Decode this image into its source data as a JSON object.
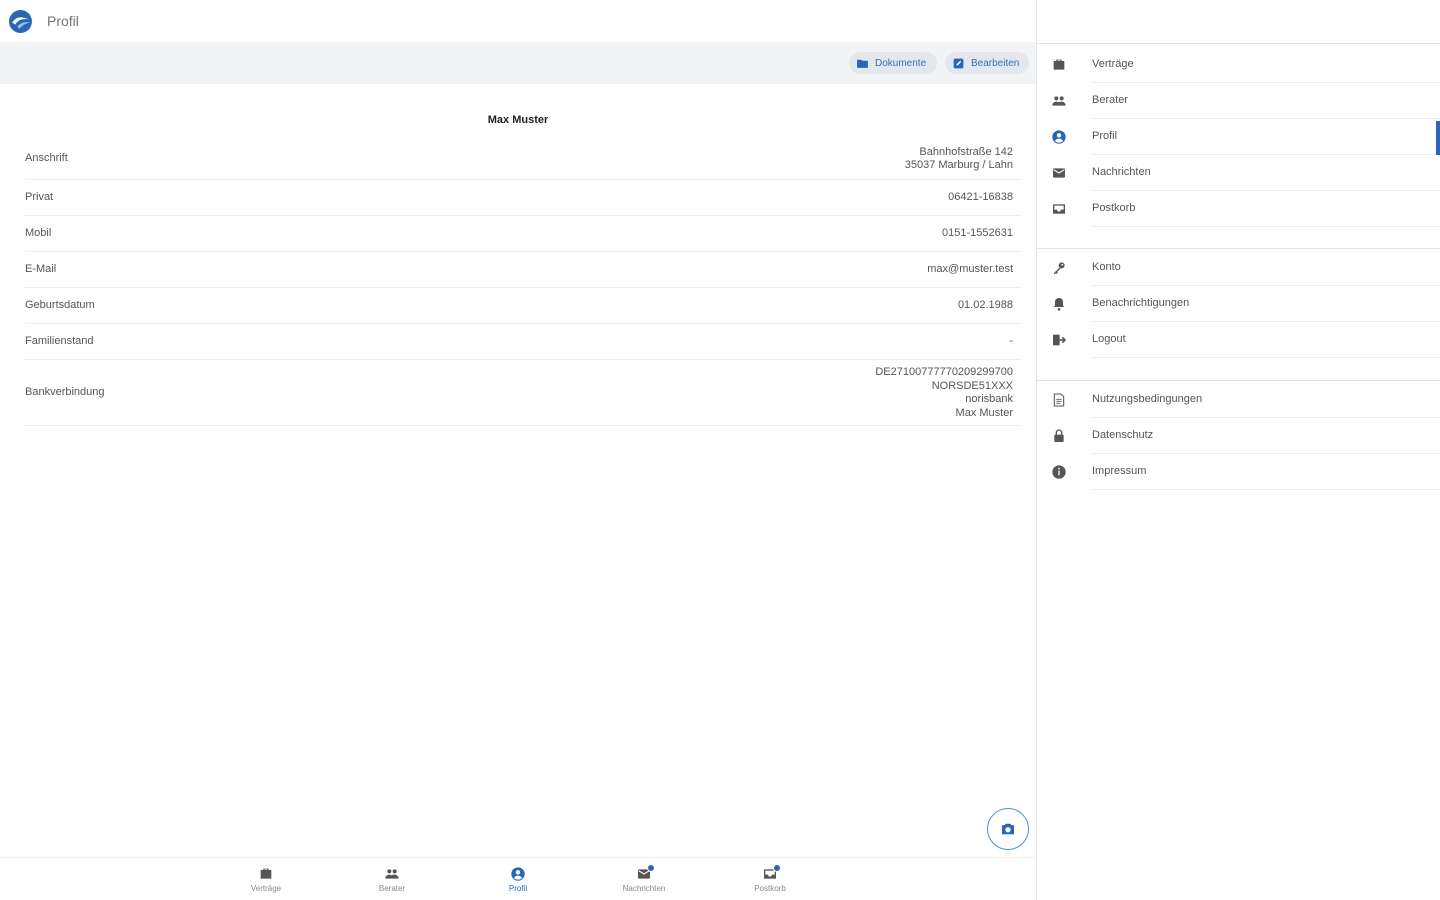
{
  "header": {
    "title": "Profil"
  },
  "actions": {
    "documents_label": "Dokumente",
    "edit_label": "Bearbeiten"
  },
  "profile": {
    "name": "Max Muster",
    "fields": [
      {
        "label": "Anschrift",
        "value_lines": [
          "Bahnhofstraße 142",
          "35037 Marburg / Lahn"
        ]
      },
      {
        "label": "Privat",
        "value_lines": [
          "06421-16838"
        ]
      },
      {
        "label": "Mobil",
        "value_lines": [
          "0151-1552631"
        ]
      },
      {
        "label": "E-Mail",
        "value_lines": [
          "max@muster.test"
        ]
      },
      {
        "label": "Geburtsdatum",
        "value_lines": [
          "01.02.1988"
        ]
      },
      {
        "label": "Familienstand",
        "value_lines": [
          "-"
        ]
      },
      {
        "label": "Bankverbindung",
        "value_lines": [
          "DE27100777770209299700",
          "NORSDE51XXX",
          "norisbank",
          "Max Muster"
        ]
      }
    ]
  },
  "bottom_nav": {
    "items": [
      {
        "label": "Verträge",
        "icon": "briefcase-icon",
        "active": false,
        "badge": false
      },
      {
        "label": "Berater",
        "icon": "people-icon",
        "active": false,
        "badge": false
      },
      {
        "label": "Profil",
        "icon": "account-circle-icon",
        "active": true,
        "badge": false
      },
      {
        "label": "Nachrichten",
        "icon": "mail-icon",
        "active": false,
        "badge": true
      },
      {
        "label": "Postkorb",
        "icon": "inbox-icon",
        "active": false,
        "badge": true
      }
    ]
  },
  "drawer": {
    "groups": [
      [
        {
          "label": "Verträge",
          "icon": "briefcase-icon",
          "active": false
        },
        {
          "label": "Berater",
          "icon": "people-icon",
          "active": false
        },
        {
          "label": "Profil",
          "icon": "account-circle-icon",
          "active": true
        },
        {
          "label": "Nachrichten",
          "icon": "mail-icon",
          "active": false
        },
        {
          "label": "Postkorb",
          "icon": "inbox-icon",
          "active": false
        }
      ],
      [
        {
          "label": "Konto",
          "icon": "key-icon",
          "active": false
        },
        {
          "label": "Benachrichtigungen",
          "icon": "bell-icon",
          "active": false
        },
        {
          "label": "Logout",
          "icon": "logout-icon",
          "active": false
        }
      ],
      [
        {
          "label": "Nutzungsbedingungen",
          "icon": "document-icon",
          "active": false
        },
        {
          "label": "Datenschutz",
          "icon": "lock-icon",
          "active": false
        },
        {
          "label": "Impressum",
          "icon": "info-icon",
          "active": false
        }
      ]
    ]
  },
  "colors": {
    "accent": "#2a66b6",
    "icon": "#555555",
    "action_bar": "#f2f3f5"
  }
}
